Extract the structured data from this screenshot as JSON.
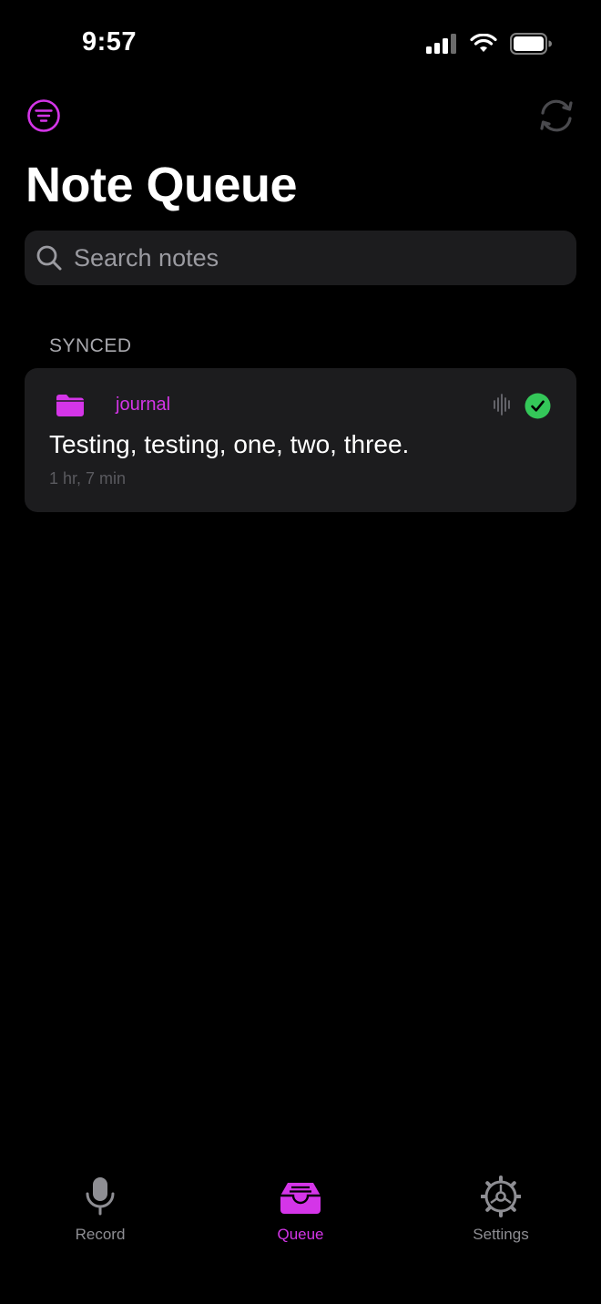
{
  "status_bar": {
    "time": "9:57"
  },
  "header": {
    "title": "Note Queue"
  },
  "search": {
    "placeholder": "Search notes"
  },
  "sections": [
    {
      "header": "SYNCED",
      "notes": [
        {
          "folder": "journal",
          "text": "Testing, testing, one, two, three.",
          "meta": "1 hr, 7 min",
          "status": "synced"
        }
      ]
    }
  ],
  "tab_bar": {
    "tabs": [
      {
        "label": "Record",
        "icon": "microphone-icon",
        "active": false
      },
      {
        "label": "Queue",
        "icon": "tray-icon",
        "active": true
      },
      {
        "label": "Settings",
        "icon": "gear-icon",
        "active": false
      }
    ]
  },
  "colors": {
    "accent": "#d435e8",
    "success": "#34c759",
    "background": "#000000",
    "card": "#1c1c1e"
  }
}
